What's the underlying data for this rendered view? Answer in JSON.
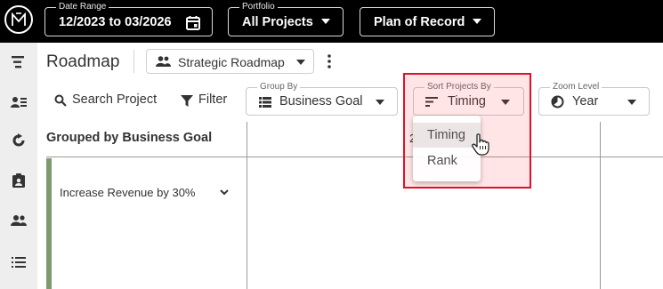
{
  "topbar": {
    "date_range": {
      "label": "Date Range",
      "value": "12/2023 to 03/2026",
      "icon": "calendar-icon"
    },
    "portfolio": {
      "label": "Portfolio",
      "value": "All Projects",
      "icon": "caret-down-icon"
    },
    "plan": {
      "value": "Plan of Record",
      "icon": "caret-down-icon"
    }
  },
  "sidebar": {
    "icons": [
      "roadmap-icon",
      "people-list-icon",
      "refresh-icon",
      "clipboard-icon",
      "team-icon",
      "list-icon"
    ]
  },
  "page": {
    "title": "Roadmap",
    "view_selector": "Strategic Roadmap"
  },
  "toolbar": {
    "search_label": "Search Project",
    "filter_label": "Filter",
    "group_by": {
      "label": "Group By",
      "value": "Business Goal"
    },
    "sort_by": {
      "label": "Sort Projects By",
      "value": "Timing"
    },
    "zoom_level": {
      "label": "Zoom Level",
      "value": "Year"
    }
  },
  "sort_menu": {
    "options": [
      "Timing",
      "Rank"
    ],
    "hovered": "Timing"
  },
  "grid": {
    "group_header": "Grouped by Business Goal",
    "year_partial": "2",
    "groups": [
      {
        "label": "Increase Revenue by 30%"
      }
    ]
  },
  "colors": {
    "topbar": "#000000",
    "sidebar": "#eeeeee",
    "group_accent": "#7f9a6c",
    "highlight_border": "#e0102a"
  }
}
